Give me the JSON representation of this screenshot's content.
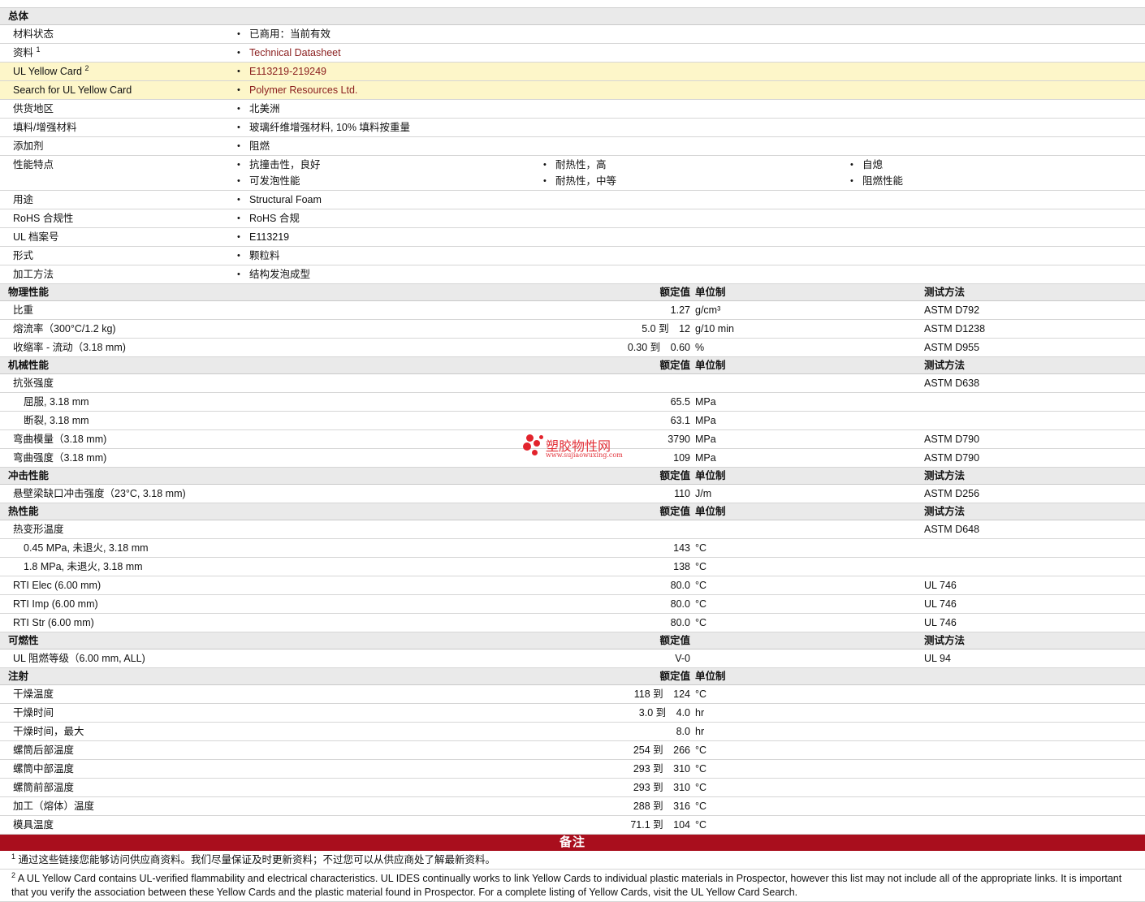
{
  "general": {
    "header": "总体",
    "rows": [
      {
        "label": "材料状态",
        "value": "已商用：当前有效",
        "link": false
      },
      {
        "label": "资料",
        "sup": "1",
        "value": "Technical Datasheet",
        "link": true
      },
      {
        "label": "UL Yellow Card",
        "sup": "2",
        "value": "E113219-219249",
        "link": true,
        "highlight": true
      },
      {
        "label": "Search for UL Yellow Card",
        "value": "Polymer Resources Ltd.",
        "link": true,
        "highlight": true
      },
      {
        "label": "供货地区",
        "value": "北美洲",
        "link": false
      },
      {
        "label": "填料/增强材料",
        "value": "玻璃纤维增强材料, 10% 填料按重量",
        "link": false
      },
      {
        "label": "添加剂",
        "value": "阻燃",
        "link": false
      }
    ],
    "features": {
      "label": "性能特点",
      "items": [
        "抗撞击性，良好",
        "可发泡性能",
        "耐热性，高",
        "耐热性，中等",
        "自熄",
        "阻燃性能"
      ]
    },
    "rows2": [
      {
        "label": "用途",
        "value": "Structural Foam",
        "link": false
      },
      {
        "label": "RoHS 合规性",
        "value": "RoHS 合规",
        "link": false
      },
      {
        "label": "UL 档案号",
        "value": "E113219",
        "link": false
      },
      {
        "label": "形式",
        "value": "颗粒料",
        "link": false
      },
      {
        "label": "加工方法",
        "value": "结构发泡成型",
        "link": false
      }
    ]
  },
  "sections": [
    {
      "title": "物理性能",
      "col_value": "额定值",
      "col_unit": "单位制",
      "col_method": "测试方法",
      "rows": [
        {
          "label": "比重",
          "value": "1.27",
          "unit": "g/cm³",
          "method": "ASTM D792"
        },
        {
          "label": "熔流率（300°C/1.2 kg)",
          "value": "5.0 到　12",
          "unit": "g/10 min",
          "method": "ASTM D1238"
        },
        {
          "label": "收缩率 - 流动（3.18 mm)",
          "value": "0.30 到　0.60",
          "unit": "%",
          "method": "ASTM D955"
        }
      ]
    },
    {
      "title": "机械性能",
      "col_value": "额定值",
      "col_unit": "单位制",
      "col_method": "测试方法",
      "rows": [
        {
          "label": "抗张强度",
          "value": "",
          "unit": "",
          "method": "ASTM D638"
        },
        {
          "label": "屈服, 3.18 mm",
          "sub": true,
          "value": "65.5",
          "unit": "MPa",
          "method": ""
        },
        {
          "label": "断裂, 3.18 mm",
          "sub": true,
          "value": "63.1",
          "unit": "MPa",
          "method": ""
        },
        {
          "label": "弯曲模量（3.18 mm)",
          "value": "3790",
          "unit": "MPa",
          "method": "ASTM D790"
        },
        {
          "label": "弯曲强度（3.18 mm)",
          "value": "109",
          "unit": "MPa",
          "method": "ASTM D790"
        }
      ]
    },
    {
      "title": "冲击性能",
      "col_value": "额定值",
      "col_unit": "单位制",
      "col_method": "测试方法",
      "rows": [
        {
          "label": "悬壁梁缺口冲击强度（23°C, 3.18 mm)",
          "value": "110",
          "unit": "J/m",
          "method": "ASTM D256"
        }
      ]
    },
    {
      "title": "热性能",
      "col_value": "额定值",
      "col_unit": "单位制",
      "col_method": "测试方法",
      "rows": [
        {
          "label": "热变形温度",
          "value": "",
          "unit": "",
          "method": "ASTM D648"
        },
        {
          "label": "0.45 MPa, 未退火, 3.18 mm",
          "sub": true,
          "value": "143",
          "unit": "°C",
          "method": ""
        },
        {
          "label": "1.8 MPa, 未退火, 3.18 mm",
          "sub": true,
          "value": "138",
          "unit": "°C",
          "method": ""
        },
        {
          "label": "RTI Elec (6.00 mm)",
          "value": "80.0",
          "unit": "°C",
          "method": "UL 746"
        },
        {
          "label": "RTI Imp (6.00 mm)",
          "value": "80.0",
          "unit": "°C",
          "method": "UL 746"
        },
        {
          "label": "RTI Str (6.00 mm)",
          "value": "80.0",
          "unit": "°C",
          "method": "UL 746"
        }
      ]
    },
    {
      "title": "可燃性",
      "col_value": "额定值",
      "col_unit": "",
      "col_method": "测试方法",
      "rows": [
        {
          "label": "UL 阻燃等级（6.00 mm, ALL)",
          "value": "V-0",
          "unit": "",
          "method": "UL 94"
        }
      ]
    },
    {
      "title": "注射",
      "col_value": "额定值",
      "col_unit": "单位制",
      "col_method": "",
      "rows": [
        {
          "label": "干燥温度",
          "value": "118 到　124",
          "unit": "°C",
          "method": ""
        },
        {
          "label": "干燥时间",
          "value": "3.0 到　4.0",
          "unit": "hr",
          "method": ""
        },
        {
          "label": "干燥时间，最大",
          "value": "8.0",
          "unit": "hr",
          "method": ""
        },
        {
          "label": "螺筒后部温度",
          "value": "254 到　266",
          "unit": "°C",
          "method": ""
        },
        {
          "label": "螺筒中部温度",
          "value": "293 到　310",
          "unit": "°C",
          "method": ""
        },
        {
          "label": "螺筒前部温度",
          "value": "293 到　310",
          "unit": "°C",
          "method": ""
        },
        {
          "label": "加工（熔体）温度",
          "value": "288 到　316",
          "unit": "°C",
          "method": ""
        },
        {
          "label": "模具温度",
          "value": "71.1 到　104",
          "unit": "°C",
          "method": ""
        }
      ]
    }
  ],
  "notes": {
    "title": "备注",
    "items": [
      {
        "sup": "1",
        "text": "通过这些链接您能够访问供应商资料。我们尽量保证及时更新资料；不过您可以从供应商处了解最新资料。"
      },
      {
        "sup": "2",
        "text": "A UL Yellow Card contains UL-verified flammability and electrical characteristics. UL IDES continually works to link Yellow Cards to individual plastic materials in Prospector, however this list may not include all of the appropriate links. It is important that you verify the association between these Yellow Cards and the plastic material found in Prospector. For a complete listing of Yellow Cards, visit the UL Yellow Card Search."
      }
    ]
  },
  "watermark": {
    "title": "塑胶物性网",
    "url": "www.sujiaowuxing.com",
    "color": "#e2232c"
  }
}
